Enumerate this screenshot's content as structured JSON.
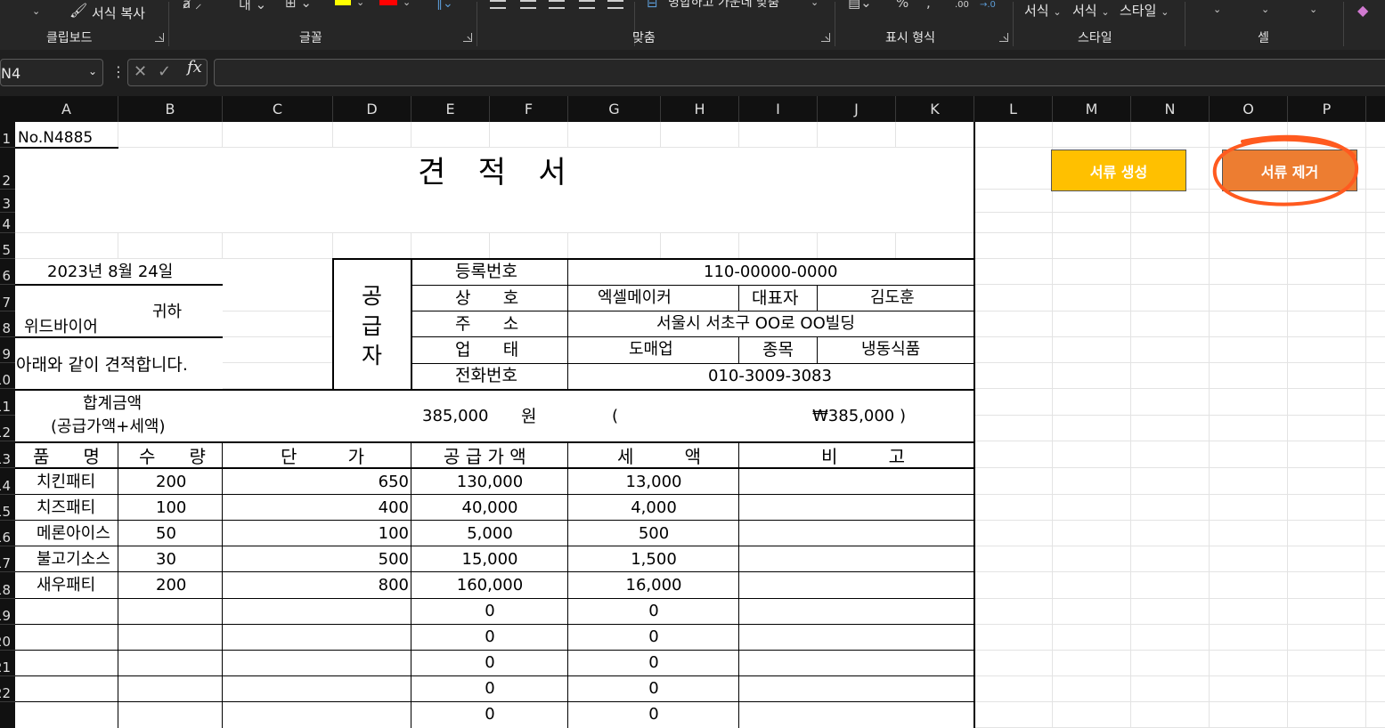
{
  "ribbon": {
    "clipboard_format_painter": "서식 복사",
    "groups": {
      "clipboard": "클립보드",
      "font": "글꼴",
      "alignment": "맞춤",
      "number": "표시 형식",
      "styles": "스타일",
      "cells": "셀"
    },
    "merge_label": "병합하고 가운데 맞춤",
    "percent_symbol": "%",
    "comma_symbol": ",",
    "decimal_increase": ".00",
    "decimal_decrease": "→.0",
    "style_buttons": [
      "서식",
      "서식",
      "스타일"
    ],
    "font_color_accent": "#ff0000",
    "fill_color_accent": "#ffff00"
  },
  "formula_bar": {
    "name_box": "N4",
    "fx": "fx",
    "value": ""
  },
  "columns": [
    "A",
    "B",
    "C",
    "D",
    "E",
    "F",
    "G",
    "H",
    "I",
    "J",
    "K",
    "L",
    "M",
    "N",
    "O",
    "P"
  ],
  "rows": [
    "1",
    "2",
    "3",
    "4",
    "5",
    "6",
    "7",
    "8",
    "9",
    "10",
    "11",
    "12",
    "13",
    "14",
    "15",
    "16",
    "17",
    "18",
    "19",
    "20",
    "21",
    "22"
  ],
  "quote": {
    "doc_no": "No.N4885",
    "title": "견   적   서",
    "date": "2023년 8월 24일",
    "recipient": "위드바이어",
    "honorific": "귀하",
    "greeting": "아래와 같이 견적합니다.",
    "supplier_vertical": [
      "공",
      "급",
      "자"
    ],
    "supplier": {
      "reg_no_label": "등록번호",
      "reg_no": "110-00000-0000",
      "company_label": "상      호",
      "company": "엑셀메이커",
      "ceo_label": "대표자",
      "ceo": "김도훈",
      "address_label": "주      소",
      "address": "서울시 서초구 OO로 OO빌딩",
      "business_type_label": "업      태",
      "business_type": "도매업",
      "item_label": "종목",
      "item": "냉동식품",
      "phone_label": "전화번호",
      "phone": "010-3009-3083"
    },
    "total_label_1": "합계금액",
    "total_label_2": "(공급가액+세액)",
    "total_amount": "385,000",
    "won": "원",
    "paren_open": "(",
    "total_won": "₩385,000 )",
    "table_headers": [
      "품      명",
      "수      량",
      "단         가",
      "공 급 가 액",
      "세         액",
      "비         고"
    ],
    "items": [
      {
        "name": "치킨패티",
        "qty": "200",
        "price": "650",
        "supply": "130,000",
        "tax": "13,000"
      },
      {
        "name": "치즈패티",
        "qty": "100",
        "price": "400",
        "supply": "40,000",
        "tax": "4,000"
      },
      {
        "name": "메론아이스",
        "qty": "50",
        "price": "100",
        "supply": "5,000",
        "tax": "500"
      },
      {
        "name": "불고기소스",
        "qty": "30",
        "price": "500",
        "supply": "15,000",
        "tax": "1,500"
      },
      {
        "name": "새우패티",
        "qty": "200",
        "price": "800",
        "supply": "160,000",
        "tax": "16,000"
      },
      {
        "name": "",
        "qty": "",
        "price": "",
        "supply": "0",
        "tax": "0"
      },
      {
        "name": "",
        "qty": "",
        "price": "",
        "supply": "0",
        "tax": "0"
      },
      {
        "name": "",
        "qty": "",
        "price": "",
        "supply": "0",
        "tax": "0"
      },
      {
        "name": "",
        "qty": "",
        "price": "",
        "supply": "0",
        "tax": "0"
      },
      {
        "name": "",
        "qty": "",
        "price": "",
        "supply": "0",
        "tax": "0"
      }
    ]
  },
  "buttons": {
    "create": {
      "label": "서류 생성",
      "color": "#ffc000"
    },
    "remove": {
      "label": "서류 제거",
      "color": "#ed7d31"
    }
  },
  "annotation_color": "#ff5a1f"
}
